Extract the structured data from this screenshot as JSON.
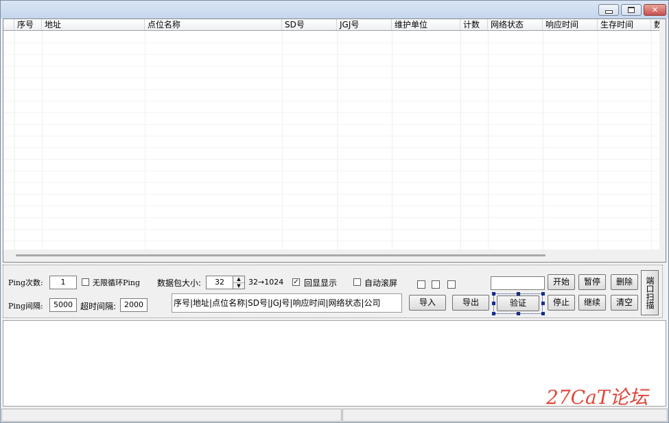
{
  "window": {
    "controls": {
      "minimize": "minimize",
      "maximize": "maximize",
      "close": "✕"
    }
  },
  "table": {
    "columns": [
      "序号",
      "地址",
      "点位名称",
      "SD号",
      "JGJ号",
      "维护单位",
      "计数",
      "网络状态",
      "响应时间",
      "生存时间",
      "数"
    ],
    "rows": []
  },
  "controls": {
    "ping_count_label": "Ping次数:",
    "ping_count_value": "1",
    "infinite_loop_label": "无限循环Ping",
    "infinite_loop_checked": false,
    "packet_size_label": "数据包大小:",
    "packet_size_value": "32",
    "packet_size_range": "32→1024",
    "echo_display_label": "回显显示",
    "echo_display_checked": true,
    "auto_scroll_label": "自动滚屏",
    "auto_scroll_checked": false,
    "ping_interval_label": "Ping间隔:",
    "ping_interval_value": "5000",
    "timeout_label": "超时间隔:",
    "timeout_value": "2000",
    "field_format": "序号|地址|点位名称|SD号|JGJ号|响应时间|网络状态|公司",
    "search_value": ""
  },
  "buttons": {
    "import": "导入",
    "export": "导出",
    "verify": "验证",
    "start": "开始",
    "pause": "暂停",
    "delete": "删除",
    "stop": "停止",
    "resume": "继续",
    "clear": "清空",
    "port_scan": "端口扫描"
  },
  "watermark": "27CaT论坛"
}
